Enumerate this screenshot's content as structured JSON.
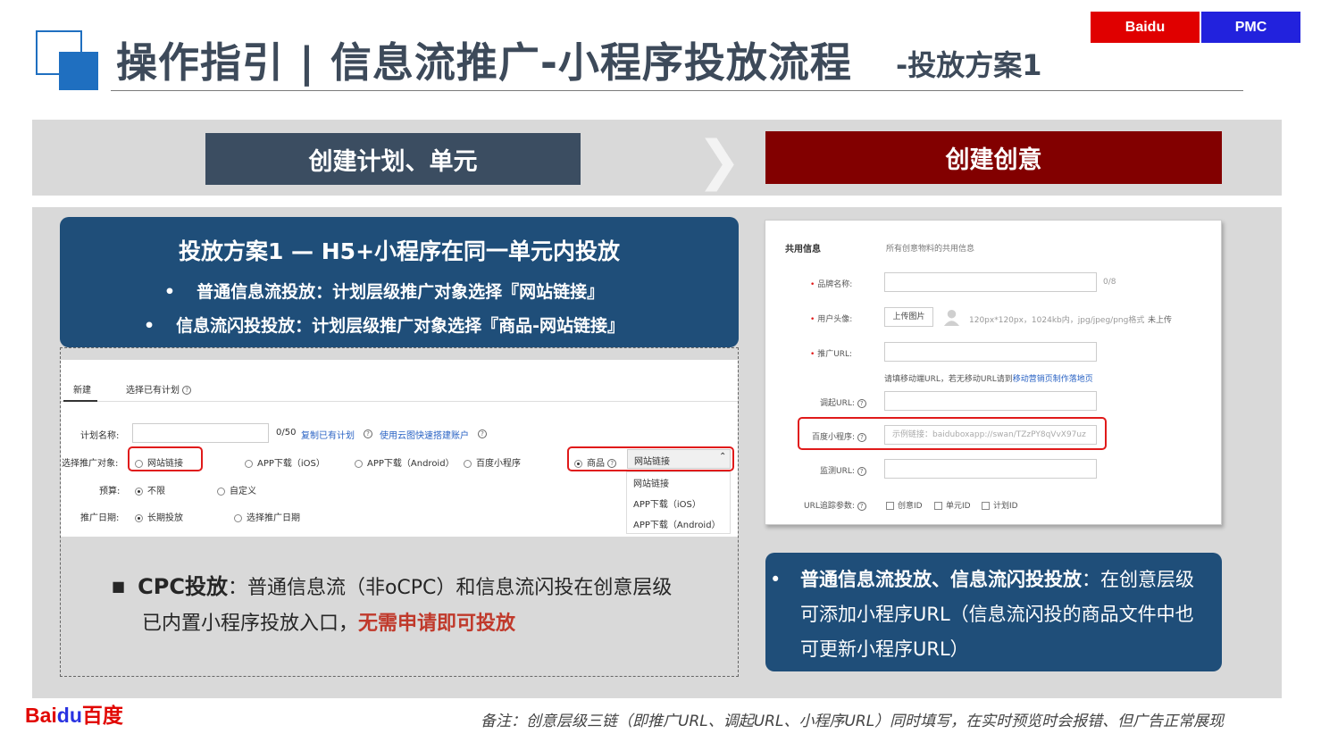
{
  "header": {
    "title": "操作指引 | 信息流推广-小程序投放流程",
    "subtitle": "-投放方案1",
    "tags": [
      "Baidu",
      "PMC"
    ]
  },
  "steps": {
    "left": "创建计划、单元",
    "arrow": "❯",
    "right": "创建创意"
  },
  "left_box": {
    "title": "投放方案1 — H5+小程序在同一单元内投放",
    "bullet_char": "•",
    "bullets": [
      "普通信息流投放：计划层级推广对象选择『网站链接』",
      "信息流闪投投放：计划层级推广对象选择『商品-网站链接』"
    ]
  },
  "plan_form": {
    "tabs": [
      "新建",
      "选择已有计划"
    ],
    "plan_name_label": "计划名称:",
    "plan_name_count": "0/50",
    "copy_link": "复制已有计划",
    "cloud_link": "使用云图快速搭建账户",
    "target_label": "选择推广对象:",
    "targets": [
      "网站链接",
      "APP下载（iOS）",
      "APP下载（Android）",
      "百度小程序",
      "商品"
    ],
    "dropdown_selected": "网站链接",
    "dropdown_options": [
      "网站链接",
      "APP下载（iOS）",
      "APP下载（Android）"
    ],
    "budget_label": "预算:",
    "budget_options": [
      "不限",
      "自定义"
    ],
    "date_label": "推广日期:",
    "date_options": [
      "长期投放",
      "选择推广日期"
    ]
  },
  "cpc_note": {
    "bullet": "■",
    "lead": "CPC投放",
    "text1": "：普通信息流（非oCPC）和信息流闪投在创意层级",
    "text2": "已内置小程序投放入口，",
    "highlight": "无需申请即可投放"
  },
  "creative_form": {
    "section": "共用信息",
    "section_desc": "所有创意物料的共用信息",
    "brand_label": "品牌名称:",
    "brand_count": "0/8",
    "avatar_label": "用户头像:",
    "upload_label": "上传图片",
    "avatar_hint": "120px*120px，1024kb内，jpg/jpeg/png格式",
    "avatar_status": "未上传",
    "url_label": "推广URL:",
    "url_hint": "请填移动端URL，若无移动URL请到",
    "url_hint_link": "移动营销页制作落地页",
    "wake_label": "调起URL:",
    "mini_label": "百度小程序:",
    "mini_placeholder": "示例链接：baiduboxapp://swan/TZzPY8qVvX97uz",
    "monitor_label": "监测URL:",
    "track_label": "URL追踪参数:",
    "track_options": [
      "创意ID",
      "单元ID",
      "计划ID"
    ],
    "required_mark": "•",
    "help_mark": "?"
  },
  "right_box": {
    "bullet": "•",
    "lead": "普通信息流投放、信息流闪投投放",
    "text": "：在创意层级可添加小程序URL（信息流闪投的商品文件中也可更新小程序URL）"
  },
  "footer": {
    "logo_bai": "Bai",
    "logo_du": "du",
    "logo_cn": "百度",
    "note": "备注：创意层级三链（即推广URL、调起URL、小程序URL）同时填写，在实时预览时会报错、但广告正常展现"
  },
  "colors": {
    "title": "#3d4a5a",
    "dark_blue": "#1f4e79",
    "slate": "#3b4d61",
    "dark_red": "#820000",
    "baidu_red": "#e00000",
    "pmc_blue": "#2222dd",
    "highlight_red": "#c0392b"
  }
}
